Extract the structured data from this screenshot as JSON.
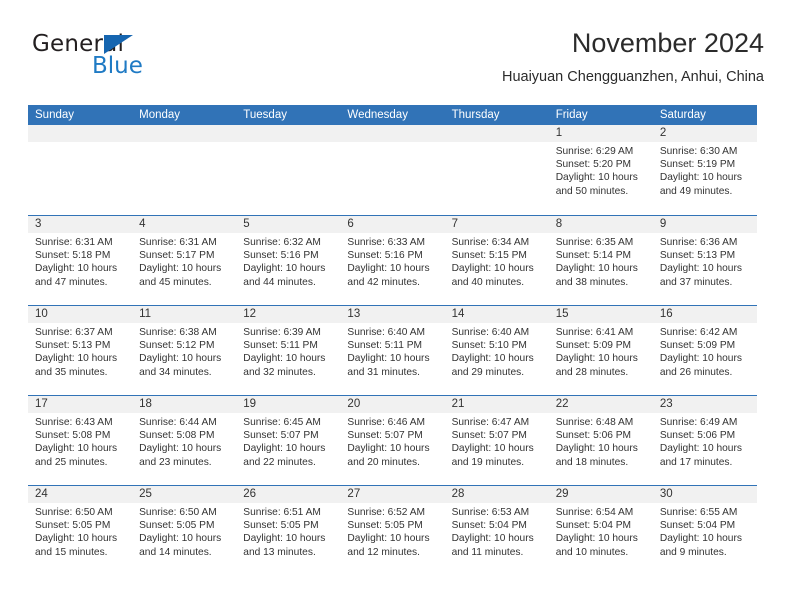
{
  "brand": {
    "name_part1": "General",
    "name_part2": "Blue",
    "triangle_color": "#1565b0",
    "blue_color": "#1f7ac4"
  },
  "header": {
    "title": "November 2024",
    "subtitle": "Huaiyuan Chengguanzhen, Anhui, China"
  },
  "theme": {
    "header_blue": "#3173b7",
    "date_strip_gray": "#f1f1f1",
    "text_color": "#333333"
  },
  "weekdays": [
    "Sunday",
    "Monday",
    "Tuesday",
    "Wednesday",
    "Thursday",
    "Friday",
    "Saturday"
  ],
  "weeks": [
    [
      {
        "day": "",
        "sunrise": "",
        "sunset": "",
        "daylight_line1": "",
        "daylight_line2": ""
      },
      {
        "day": "",
        "sunrise": "",
        "sunset": "",
        "daylight_line1": "",
        "daylight_line2": ""
      },
      {
        "day": "",
        "sunrise": "",
        "sunset": "",
        "daylight_line1": "",
        "daylight_line2": ""
      },
      {
        "day": "",
        "sunrise": "",
        "sunset": "",
        "daylight_line1": "",
        "daylight_line2": ""
      },
      {
        "day": "",
        "sunrise": "",
        "sunset": "",
        "daylight_line1": "",
        "daylight_line2": ""
      },
      {
        "day": "1",
        "sunrise": "Sunrise: 6:29 AM",
        "sunset": "Sunset: 5:20 PM",
        "daylight_line1": "Daylight: 10 hours",
        "daylight_line2": "and 50 minutes."
      },
      {
        "day": "2",
        "sunrise": "Sunrise: 6:30 AM",
        "sunset": "Sunset: 5:19 PM",
        "daylight_line1": "Daylight: 10 hours",
        "daylight_line2": "and 49 minutes."
      }
    ],
    [
      {
        "day": "3",
        "sunrise": "Sunrise: 6:31 AM",
        "sunset": "Sunset: 5:18 PM",
        "daylight_line1": "Daylight: 10 hours",
        "daylight_line2": "and 47 minutes."
      },
      {
        "day": "4",
        "sunrise": "Sunrise: 6:31 AM",
        "sunset": "Sunset: 5:17 PM",
        "daylight_line1": "Daylight: 10 hours",
        "daylight_line2": "and 45 minutes."
      },
      {
        "day": "5",
        "sunrise": "Sunrise: 6:32 AM",
        "sunset": "Sunset: 5:16 PM",
        "daylight_line1": "Daylight: 10 hours",
        "daylight_line2": "and 44 minutes."
      },
      {
        "day": "6",
        "sunrise": "Sunrise: 6:33 AM",
        "sunset": "Sunset: 5:16 PM",
        "daylight_line1": "Daylight: 10 hours",
        "daylight_line2": "and 42 minutes."
      },
      {
        "day": "7",
        "sunrise": "Sunrise: 6:34 AM",
        "sunset": "Sunset: 5:15 PM",
        "daylight_line1": "Daylight: 10 hours",
        "daylight_line2": "and 40 minutes."
      },
      {
        "day": "8",
        "sunrise": "Sunrise: 6:35 AM",
        "sunset": "Sunset: 5:14 PM",
        "daylight_line1": "Daylight: 10 hours",
        "daylight_line2": "and 38 minutes."
      },
      {
        "day": "9",
        "sunrise": "Sunrise: 6:36 AM",
        "sunset": "Sunset: 5:13 PM",
        "daylight_line1": "Daylight: 10 hours",
        "daylight_line2": "and 37 minutes."
      }
    ],
    [
      {
        "day": "10",
        "sunrise": "Sunrise: 6:37 AM",
        "sunset": "Sunset: 5:13 PM",
        "daylight_line1": "Daylight: 10 hours",
        "daylight_line2": "and 35 minutes."
      },
      {
        "day": "11",
        "sunrise": "Sunrise: 6:38 AM",
        "sunset": "Sunset: 5:12 PM",
        "daylight_line1": "Daylight: 10 hours",
        "daylight_line2": "and 34 minutes."
      },
      {
        "day": "12",
        "sunrise": "Sunrise: 6:39 AM",
        "sunset": "Sunset: 5:11 PM",
        "daylight_line1": "Daylight: 10 hours",
        "daylight_line2": "and 32 minutes."
      },
      {
        "day": "13",
        "sunrise": "Sunrise: 6:40 AM",
        "sunset": "Sunset: 5:11 PM",
        "daylight_line1": "Daylight: 10 hours",
        "daylight_line2": "and 31 minutes."
      },
      {
        "day": "14",
        "sunrise": "Sunrise: 6:40 AM",
        "sunset": "Sunset: 5:10 PM",
        "daylight_line1": "Daylight: 10 hours",
        "daylight_line2": "and 29 minutes."
      },
      {
        "day": "15",
        "sunrise": "Sunrise: 6:41 AM",
        "sunset": "Sunset: 5:09 PM",
        "daylight_line1": "Daylight: 10 hours",
        "daylight_line2": "and 28 minutes."
      },
      {
        "day": "16",
        "sunrise": "Sunrise: 6:42 AM",
        "sunset": "Sunset: 5:09 PM",
        "daylight_line1": "Daylight: 10 hours",
        "daylight_line2": "and 26 minutes."
      }
    ],
    [
      {
        "day": "17",
        "sunrise": "Sunrise: 6:43 AM",
        "sunset": "Sunset: 5:08 PM",
        "daylight_line1": "Daylight: 10 hours",
        "daylight_line2": "and 25 minutes."
      },
      {
        "day": "18",
        "sunrise": "Sunrise: 6:44 AM",
        "sunset": "Sunset: 5:08 PM",
        "daylight_line1": "Daylight: 10 hours",
        "daylight_line2": "and 23 minutes."
      },
      {
        "day": "19",
        "sunrise": "Sunrise: 6:45 AM",
        "sunset": "Sunset: 5:07 PM",
        "daylight_line1": "Daylight: 10 hours",
        "daylight_line2": "and 22 minutes."
      },
      {
        "day": "20",
        "sunrise": "Sunrise: 6:46 AM",
        "sunset": "Sunset: 5:07 PM",
        "daylight_line1": "Daylight: 10 hours",
        "daylight_line2": "and 20 minutes."
      },
      {
        "day": "21",
        "sunrise": "Sunrise: 6:47 AM",
        "sunset": "Sunset: 5:07 PM",
        "daylight_line1": "Daylight: 10 hours",
        "daylight_line2": "and 19 minutes."
      },
      {
        "day": "22",
        "sunrise": "Sunrise: 6:48 AM",
        "sunset": "Sunset: 5:06 PM",
        "daylight_line1": "Daylight: 10 hours",
        "daylight_line2": "and 18 minutes."
      },
      {
        "day": "23",
        "sunrise": "Sunrise: 6:49 AM",
        "sunset": "Sunset: 5:06 PM",
        "daylight_line1": "Daylight: 10 hours",
        "daylight_line2": "and 17 minutes."
      }
    ],
    [
      {
        "day": "24",
        "sunrise": "Sunrise: 6:50 AM",
        "sunset": "Sunset: 5:05 PM",
        "daylight_line1": "Daylight: 10 hours",
        "daylight_line2": "and 15 minutes."
      },
      {
        "day": "25",
        "sunrise": "Sunrise: 6:50 AM",
        "sunset": "Sunset: 5:05 PM",
        "daylight_line1": "Daylight: 10 hours",
        "daylight_line2": "and 14 minutes."
      },
      {
        "day": "26",
        "sunrise": "Sunrise: 6:51 AM",
        "sunset": "Sunset: 5:05 PM",
        "daylight_line1": "Daylight: 10 hours",
        "daylight_line2": "and 13 minutes."
      },
      {
        "day": "27",
        "sunrise": "Sunrise: 6:52 AM",
        "sunset": "Sunset: 5:05 PM",
        "daylight_line1": "Daylight: 10 hours",
        "daylight_line2": "and 12 minutes."
      },
      {
        "day": "28",
        "sunrise": "Sunrise: 6:53 AM",
        "sunset": "Sunset: 5:04 PM",
        "daylight_line1": "Daylight: 10 hours",
        "daylight_line2": "and 11 minutes."
      },
      {
        "day": "29",
        "sunrise": "Sunrise: 6:54 AM",
        "sunset": "Sunset: 5:04 PM",
        "daylight_line1": "Daylight: 10 hours",
        "daylight_line2": "and 10 minutes."
      },
      {
        "day": "30",
        "sunrise": "Sunrise: 6:55 AM",
        "sunset": "Sunset: 5:04 PM",
        "daylight_line1": "Daylight: 10 hours",
        "daylight_line2": "and 9 minutes."
      }
    ]
  ]
}
